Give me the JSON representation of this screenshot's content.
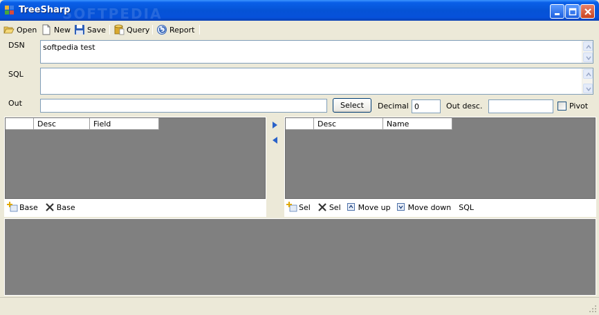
{
  "window": {
    "title": "TreeSharp",
    "watermark": "SOFTPEDIA"
  },
  "toolbar": {
    "open_label": "Open",
    "new_label": "New",
    "save_label": "Save",
    "query_label": "Query",
    "report_label": "Report"
  },
  "form": {
    "dsn_label": "DSN",
    "dsn_value": "softpedia test",
    "sql_label": "SQL",
    "sql_value": "",
    "out_label": "Out",
    "out_value": "",
    "select_label": "Select",
    "decimal_label": "Decimal",
    "decimal_value": "0",
    "out_desc_label": "Out desc.",
    "out_desc_value": "",
    "pivot_label": "Pivot",
    "pivot_checked": false
  },
  "left_grid": {
    "columns": [
      "Desc",
      "Field"
    ]
  },
  "right_grid": {
    "columns": [
      "Desc",
      "Name"
    ]
  },
  "left_actions": {
    "add_base_label": "Base",
    "remove_base_label": "Base"
  },
  "right_actions": {
    "add_sel_label": "Sel",
    "remove_sel_label": "Sel",
    "move_up_label": "Move up",
    "move_down_label": "Move down",
    "sql_label": "SQL"
  },
  "icons": {
    "open": "open-folder-icon",
    "new": "new-document-icon",
    "save": "floppy-disk-icon",
    "query": "database-icon",
    "report": "undo-arrow-icon",
    "add": "add-plus-icon",
    "remove": "x-cross-icon",
    "move_up": "arrow-up-icon",
    "move_down": "arrow-down-icon",
    "transfer_right": "arrow-right-icon",
    "transfer_left": "arrow-left-icon"
  },
  "colors": {
    "titlebar": "#0553d6",
    "grid_bg": "#808080",
    "window_bg": "#ece9d8"
  }
}
